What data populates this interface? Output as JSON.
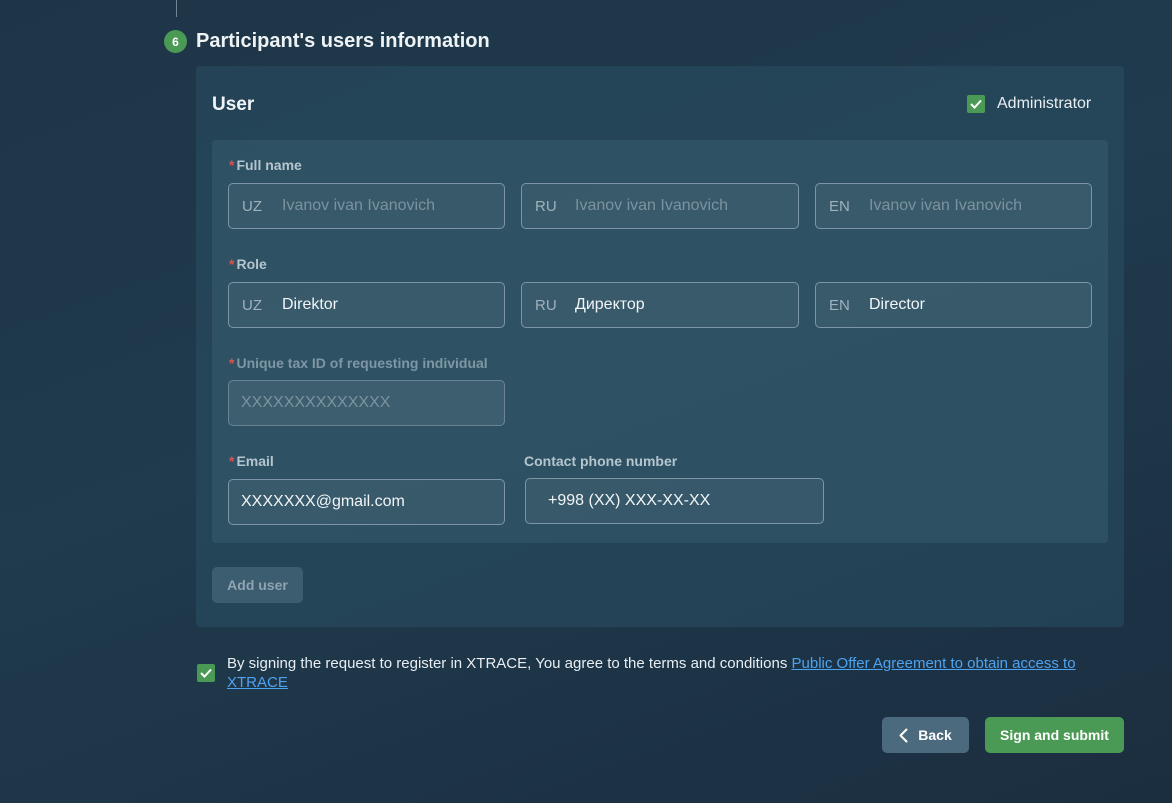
{
  "step": {
    "number": "6",
    "title": "Participant's users information"
  },
  "user_card": {
    "title": "User",
    "administrator": {
      "label": "Administrator",
      "checked": true
    },
    "full_name": {
      "label": "Full name",
      "uz": {
        "lang": "UZ",
        "placeholder": "Ivanov ivan Ivanovich"
      },
      "ru": {
        "lang": "RU",
        "placeholder": "Ivanov ivan Ivanovich"
      },
      "en": {
        "lang": "EN",
        "placeholder": "Ivanov ivan Ivanovich"
      }
    },
    "role": {
      "label": "Role",
      "uz": {
        "lang": "UZ",
        "value": "Direktor"
      },
      "ru": {
        "lang": "RU",
        "value": "Директор"
      },
      "en": {
        "lang": "EN",
        "value": "Director"
      }
    },
    "tax_id": {
      "label": "Unique tax ID of requesting individual",
      "placeholder": "XXXXXXXXXXXXXX"
    },
    "email": {
      "label": "Email",
      "value": "XXXXXXX@gmail.com"
    },
    "phone": {
      "label": "Contact phone number",
      "value": "+998 (XX) XXX-XX-XX"
    },
    "add_user_label": "Add user"
  },
  "agreement": {
    "checked": true,
    "text": "By signing the request to register in XTRACE, You agree to the terms and conditions ",
    "link_text": "Public Offer Agreement to obtain access to XTRACE"
  },
  "actions": {
    "back_label": "Back",
    "submit_label": "Sign and submit"
  },
  "colors": {
    "accent_green": "#4a9a55",
    "link_blue": "#4ea3f0",
    "required_red": "#e05050"
  }
}
